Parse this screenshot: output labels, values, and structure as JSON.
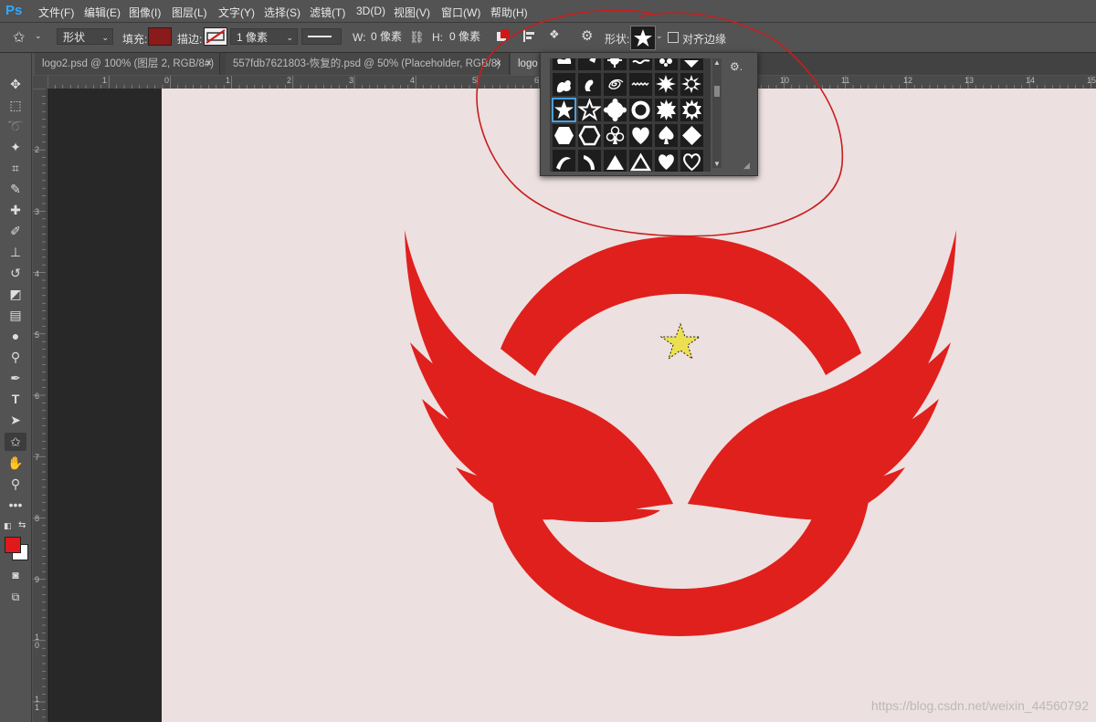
{
  "app": {
    "logo": "Ps"
  },
  "menu": [
    "文件(F)",
    "编辑(E)",
    "图像(I)",
    "图层(L)",
    "文字(Y)",
    "选择(S)",
    "滤镜(T)",
    "3D(D)",
    "视图(V)",
    "窗口(W)",
    "帮助(H)"
  ],
  "options": {
    "mode_value": "形状",
    "fill_label": "填充:",
    "fill_color": "#8b1a1a",
    "stroke_label": "描边:",
    "stroke_width_value": "1 像素",
    "width_label": "W:",
    "width_value": "0 像素",
    "height_label": "H:",
    "height_value": "0 像素",
    "shape_label": "形状:",
    "align_edges_label": "对齐边缘"
  },
  "tabs": [
    {
      "label": "logo2.psd @ 100% (图层 2, RGB/8#)"
    },
    {
      "label": "557fdb7621803-恢复的.psd @ 50% (Placeholder, RGB/8)"
    },
    {
      "label": "logo"
    }
  ],
  "ruler_top": [
    "1",
    "0",
    "1",
    "2",
    "3",
    "4",
    "5",
    "6",
    "10",
    "11",
    "12",
    "13",
    "14",
    "15"
  ],
  "ruler_left": [
    "2",
    "3",
    "4",
    "5",
    "6",
    "7",
    "8",
    "9",
    "1\n0",
    "1\n1"
  ],
  "colors": {
    "foreground": "#e01a1a",
    "background": "#ffffff",
    "logo_red": "#e0201c",
    "star_yellow": "#ece050",
    "annotation_circle": "#c81e1e"
  },
  "watermark": "https://blog.csdn.net/weixin_44560792"
}
